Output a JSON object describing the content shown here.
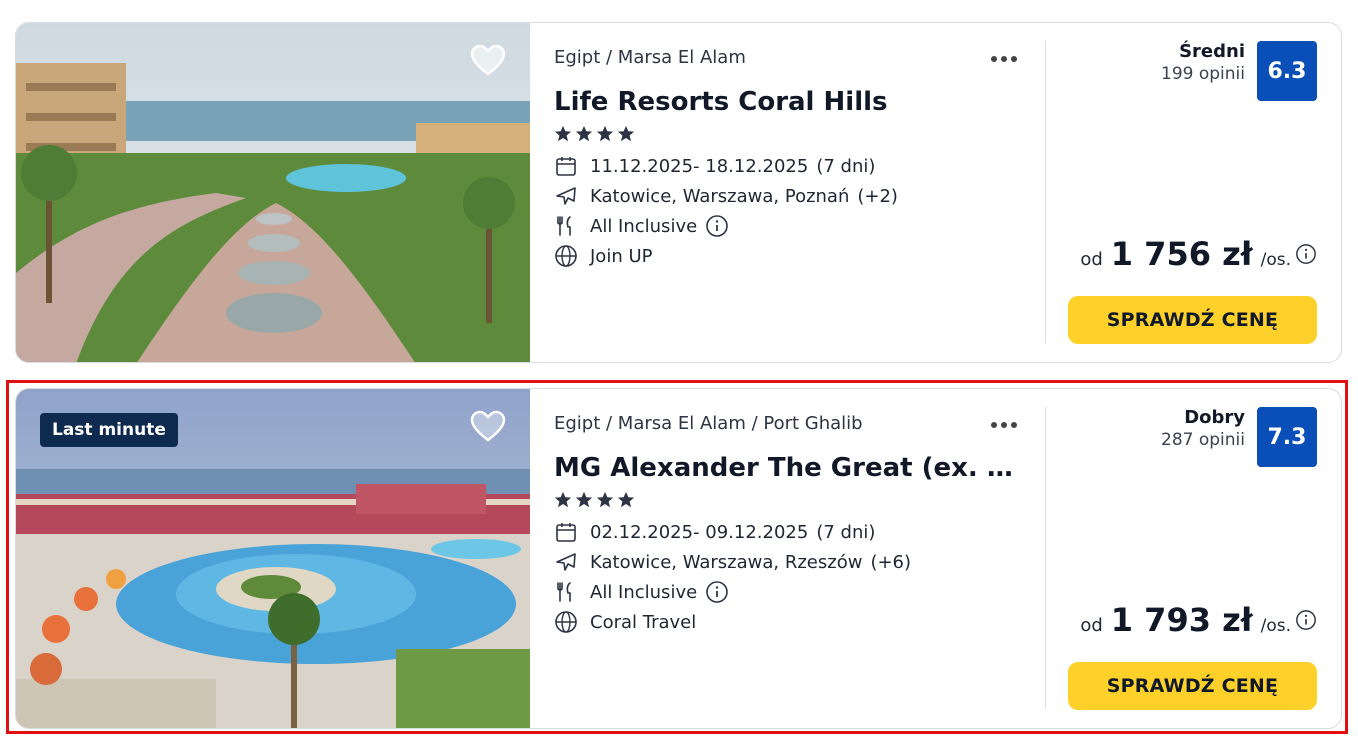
{
  "offers": [
    {
      "location": "Egipt / Marsa El Alam",
      "name": "Life Resorts Coral Hills",
      "stars": 4,
      "dates": "11.12.2025- 18.12.2025",
      "duration": "(7 dni)",
      "departures": "Katowice, Warszawa, Poznań",
      "departures_more": "(+2)",
      "board": "All Inclusive",
      "operator": "Join UP",
      "rating_word": "Średni",
      "reviews": "199 opinii",
      "score": "6.3",
      "price_prefix": "od",
      "price": "1 756 zł",
      "price_suffix": "/os.",
      "cta": "SPRAWDŹ CENĘ",
      "badge": "",
      "favorite_icon": "heart-icon"
    },
    {
      "location": "Egipt / Marsa El Alam / Port Ghalib",
      "name": "MG Alexander The Great (ex. Des...",
      "stars": 4,
      "dates": "02.12.2025- 09.12.2025",
      "duration": "(7 dni)",
      "departures": "Katowice, Warszawa, Rzeszów",
      "departures_more": "(+6)",
      "board": "All Inclusive",
      "operator": "Coral Travel",
      "rating_word": "Dobry",
      "reviews": "287 opinii",
      "score": "7.3",
      "price_prefix": "od",
      "price": "1 793 zł",
      "price_suffix": "/os.",
      "cta": "SPRAWDŹ CENĘ",
      "badge": "Last minute",
      "favorite_icon": "heart-icon"
    }
  ],
  "colors": {
    "score_bg": "#0a4fb8",
    "cta_bg": "#fdd12a",
    "badge_bg": "#0e2a4f",
    "highlight": "#e01010"
  }
}
